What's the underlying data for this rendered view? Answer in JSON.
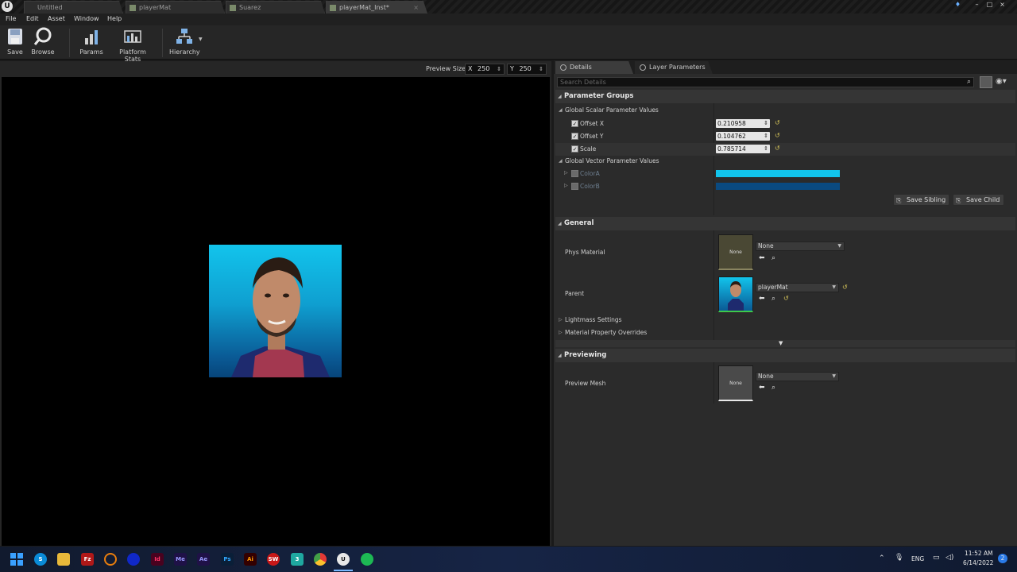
{
  "title_bar": {
    "tabs": [
      {
        "label": "Untitled",
        "active": false
      },
      {
        "label": "playerMat",
        "active": false
      },
      {
        "label": "Suarez",
        "active": false
      },
      {
        "label": "playerMat_Inst*",
        "active": true
      }
    ]
  },
  "menu": [
    "File",
    "Edit",
    "Asset",
    "Window",
    "Help"
  ],
  "toolbar": {
    "save_label": "Save",
    "browse_label": "Browse",
    "params_label": "Params",
    "platform_stats_label": "Platform Stats",
    "hierarchy_label": "Hierarchy"
  },
  "viewport": {
    "preview_size_label": "Preview Size",
    "size_x_label": "X",
    "size_x_value": "250",
    "size_y_label": "Y",
    "size_y_value": "250"
  },
  "details": {
    "tabs": [
      {
        "label": "Details",
        "active": true
      },
      {
        "label": "Layer Parameters",
        "active": false
      }
    ],
    "search_placeholder": "Search Details",
    "parameter_groups": {
      "title": "Parameter Groups",
      "scalar_group_label": "Global Scalar Parameter Values",
      "scalars": [
        {
          "name": "Offset X",
          "value": "0.210958",
          "checked": true
        },
        {
          "name": "Offset Y",
          "value": "0.104762",
          "checked": true
        },
        {
          "name": "Scale",
          "value": "0.785714",
          "checked": true
        }
      ],
      "vector_group_label": "Global Vector Parameter Values",
      "vectors": [
        {
          "name": "ColorA",
          "color": "#12c4ec",
          "checked": false
        },
        {
          "name": "ColorB",
          "color": "#0a4a80",
          "checked": false
        }
      ],
      "save_sibling_label": "Save Sibling",
      "save_child_label": "Save Child"
    },
    "general": {
      "title": "General",
      "phys_material_label": "Phys Material",
      "phys_material_thumb": "None",
      "phys_material_value": "None",
      "parent_label": "Parent",
      "parent_value": "playerMat",
      "lightmass_label": "Lightmass Settings",
      "overrides_label": "Material Property Overrides"
    },
    "previewing": {
      "title": "Previewing",
      "preview_mesh_label": "Preview Mesh",
      "preview_mesh_thumb": "None",
      "preview_mesh_value": "None"
    }
  },
  "taskbar": {
    "apps": [
      "windows-start",
      "skype",
      "file-explorer",
      "filezilla",
      "blender",
      "vpn",
      "indesign",
      "media-encoder",
      "after-effects",
      "photoshop",
      "illustrator",
      "solidworks",
      "3ds-max",
      "chrome",
      "unreal-engine",
      "spotify"
    ],
    "app_labels": {
      "skype": "S",
      "filezilla": "Fz",
      "indesign": "Id",
      "media-encoder": "Me",
      "after-effects": "Ae",
      "photoshop": "Ps",
      "illustrator": "Ai",
      "solidworks": "SW",
      "3ds-max": "3",
      "unreal-engine": "U"
    },
    "language": "ENG",
    "time": "11:52 AM",
    "date": "6/14/2022",
    "notification_count": "2"
  }
}
